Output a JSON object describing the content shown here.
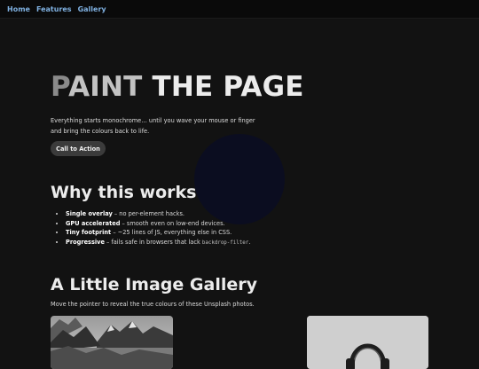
{
  "nav": {
    "items": [
      {
        "label": "Home"
      },
      {
        "label": "Features"
      },
      {
        "label": "Gallery"
      }
    ]
  },
  "hero": {
    "title_part1": "P",
    "title_part2": "AINT",
    "title_part3": " THE PAGE",
    "subtitle": "Everything starts monochrome… until you wave your mouse or finger and bring the colours back to life.",
    "cta_label": "Call to Action"
  },
  "why": {
    "title": "Why this works",
    "items": [
      {
        "bold": "Single overlay",
        "text": " – no per-element hacks."
      },
      {
        "bold": "GPU accelerated",
        "text": " – smooth even on low-end devices."
      },
      {
        "bold": "Tiny footprint",
        "text": " – ~25 lines of JS, everything else in CSS."
      },
      {
        "bold": "Progressive",
        "text": " – fails safe in browsers that lack ",
        "code": "backdrop-filter",
        "tail": "."
      }
    ]
  },
  "gallery": {
    "title": "A Little Image Gallery",
    "subtitle": "Move the pointer to reveal the true colours of these Unsplash photos."
  }
}
